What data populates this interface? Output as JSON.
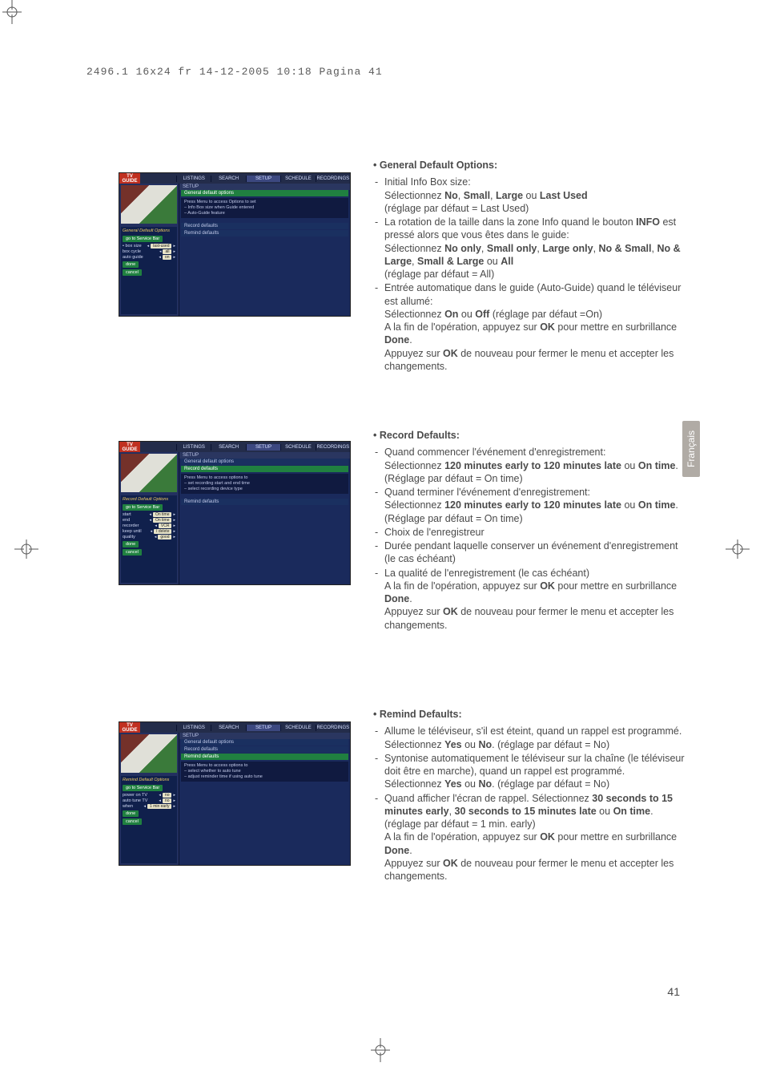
{
  "header": "2496.1 16x24 fr  14-12-2005  10:18  Pagina 41",
  "page_number": "41",
  "side_tab": "Français",
  "tvguide_logo_top": "TV",
  "tvguide_logo_bottom": "GUIDE",
  "tabs": {
    "listings": "LISTINGS",
    "search": "SEARCH",
    "setup": "SETUP",
    "schedule": "SCHEDULE",
    "recordings": "RECORDINGS"
  },
  "setup_label": "SETUP",
  "bars": {
    "general": "General default options",
    "record": "Record defaults",
    "remind": "Remind defaults"
  },
  "shot1": {
    "title": "General Default Options",
    "back": "go to Service Bar",
    "rows": {
      "boxsize_lbl": "• box size",
      "boxsize_val": "last-used",
      "boxcycle_lbl": "box cycle",
      "boxcycle_val": "all",
      "autoguide_lbl": "auto guide",
      "autoguide_val": "on"
    },
    "done": "done",
    "cancel": "cancel",
    "info_l1": "Press Menu to access Options to set",
    "info_l2": "– Info Box size when Guide entered",
    "info_l3": "– Auto-Guide feature"
  },
  "shot2": {
    "title": "Record Default Options",
    "back": "go to Service Bar",
    "rows": {
      "start_lbl": "start",
      "start_val": "On time",
      "end_lbl": "end",
      "end_val": "On time",
      "recorder_lbl": "recorder",
      "recorder_val": "VCR",
      "keep_lbl": "keep until",
      "keep_val": "I delete",
      "quality_lbl": "quality",
      "quality_val": "good"
    },
    "done": "done",
    "cancel": "cancel",
    "info_l1": "Press Menu to access options to",
    "info_l2": "– set recording start and end time",
    "info_l3": "– select recording device type"
  },
  "shot3": {
    "title": "Remind Default Options",
    "back": "go to Service Bar",
    "rows": {
      "poweron_lbl": "power on TV",
      "poweron_val": "no",
      "autotune_lbl": "auto tune TV",
      "autotune_val": "no",
      "when_lbl": "when",
      "when_val": "1 min early"
    },
    "done": "done",
    "cancel": "cancel",
    "info_l1": "Press Menu to access options to",
    "info_l2": "– select whether to auto tune",
    "info_l3": "– adjust reminder time if using auto tune"
  },
  "text1": {
    "title": "General Default Options:",
    "i1a": "Initial Info Box size:",
    "i1b_pre": "Sélectionnez ",
    "i1b_no": "No",
    "i1b_c1": ", ",
    "i1b_sm": "Small",
    "i1b_c2": ", ",
    "i1b_lg": "Large",
    "i1b_c3": " ou ",
    "i1b_lu": "Last Used",
    "i1c": "(réglage par défaut = Last Used)",
    "i2a": "La rotation de la taille dans la zone Info quand le bouton ",
    "i2a_info": "INFO",
    "i2a_post": " est pressé alors que vous êtes dans le guide:",
    "i2b_pre": "Sélectionnez ",
    "i2b_1": "No only",
    "i2b_c1": ", ",
    "i2b_2": "Small only",
    "i2b_c2": ", ",
    "i2b_3": "Large only",
    "i2b_c3": ", ",
    "i2b_4": "No & Small",
    "i2b_c4": ", ",
    "i2b_5": "No & Large",
    "i2b_c5": ", ",
    "i2b_6": "Small & Large",
    "i2b_c6": " ou ",
    "i2b_7": "All",
    "i2c": "(réglage par défaut = All)",
    "i3a": "Entrée automatique dans le guide (Auto-Guide) quand le téléviseur est allumé:",
    "i3b_pre": "Sélectionnez ",
    "i3b_on": "On",
    "i3b_or": " ou ",
    "i3b_off": "Off",
    "i3b_post": " (réglage par défaut =On)",
    "i3c_pre": "A la fin de l'opération, appuyez sur ",
    "i3c_ok": "OK",
    "i3c_mid": " pour mettre en surbrillance ",
    "i3c_done": "Done",
    "i3c_post": ".",
    "i3d_pre": "Appuyez sur ",
    "i3d_ok": "OK",
    "i3d_post": " de nouveau pour fermer le menu et accepter les changements."
  },
  "text2": {
    "title": "Record Defaults:",
    "i1a": "Quand commencer l'événement d'enregistrement:",
    "i1b_pre": "Sélectionnez ",
    "i1b_1": "120 minutes early to 120 minutes late",
    "i1b_or": " ou ",
    "i1b_2": "On time",
    "i1b_post": ".",
    "i1c": "(Réglage par défaut = On time)",
    "i2a": "Quand terminer l'événement d'enregistrement:",
    "i2b_pre": "Sélectionnez ",
    "i2b_1": "120 minutes early to 120 minutes late",
    "i2b_or": " ou ",
    "i2b_2": "On time",
    "i2b_post": ". (Réglage par défaut = On time)",
    "i3": "Choix de l'enregistreur",
    "i4": "Durée pendant laquelle conserver un événement d'enregistrement (le cas échéant)",
    "i5": "La qualité de l'enregistrement (le cas échéant)",
    "i5b_pre": "A la fin de l'opération, appuyez sur ",
    "i5b_ok": "OK",
    "i5b_mid": " pour mettre en surbrillance ",
    "i5b_done": "Done",
    "i5b_post": ".",
    "i5c_pre": "Appuyez sur ",
    "i5c_ok": "OK",
    "i5c_post": " de nouveau pour fermer le menu et accepter les changements."
  },
  "text3": {
    "title": "Remind Defaults:",
    "i1a": "Allume le téléviseur, s'il est éteint, quand un rappel est programmé.",
    "i1b_pre": "Sélectionnez ",
    "i1b_y": "Yes",
    "i1b_or": " ou ",
    "i1b_n": "No",
    "i1b_post": ". (réglage par défaut = No)",
    "i2a": "Syntonise automatiquement le téléviseur sur la chaîne (le téléviseur doit être en marche), quand un rappel est programmé.",
    "i2b_pre": "Sélectionnez ",
    "i2b_y": "Yes",
    "i2b_or": " ou ",
    "i2b_n": "No",
    "i2b_post": ". (réglage par défaut = No)",
    "i3a_pre": "Quand afficher l'écran de rappel. Sélectionnez ",
    "i3a_1": "30 seconds to 15 minutes early",
    "i3a_c1": ", ",
    "i3a_2": "30 seconds to 15 minutes late",
    "i3a_or": " ou ",
    "i3a_3": "On time",
    "i3a_post": ". (réglage par défaut = 1 min. early)",
    "i3b_pre": "A la fin de l'opération, appuyez sur ",
    "i3b_ok": "OK",
    "i3b_mid": " pour mettre en surbrillance ",
    "i3b_done": "Done",
    "i3b_post": ".",
    "i3c_pre": "Appuyez sur ",
    "i3c_ok": "OK",
    "i3c_post": " de nouveau pour fermer le menu et accepter les changements."
  }
}
